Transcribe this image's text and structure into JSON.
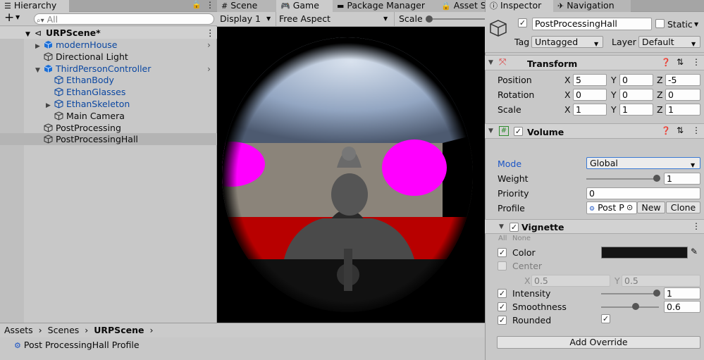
{
  "hierarchy": {
    "tab_label": "Hierarchy",
    "search_placeholder": "All",
    "add_label": "+",
    "scene": "URPScene*",
    "items": [
      {
        "label": "modernHouse",
        "style": "prefab",
        "expander": "collapsed",
        "depth": 1,
        "chevron": true
      },
      {
        "label": "Directional Light",
        "style": "normal",
        "expander": "none",
        "depth": 1,
        "chevron": false
      },
      {
        "label": "ThirdPersonController",
        "style": "prefab",
        "expander": "expanded",
        "depth": 1,
        "chevron": true
      },
      {
        "label": "EthanBody",
        "style": "prefab-child",
        "expander": "none",
        "depth": 2,
        "chevron": false
      },
      {
        "label": "EthanGlasses",
        "style": "prefab-child",
        "expander": "none",
        "depth": 2,
        "chevron": false
      },
      {
        "label": "EthanSkeleton",
        "style": "prefab-child",
        "expander": "collapsed",
        "depth": 2,
        "chevron": false
      },
      {
        "label": "Main Camera",
        "style": "normal",
        "expander": "none",
        "depth": 2,
        "chevron": false
      },
      {
        "label": "PostProcessing",
        "style": "normal",
        "expander": "none",
        "depth": 1,
        "chevron": false
      },
      {
        "label": "PostProcessingHall",
        "style": "selected",
        "expander": "none",
        "depth": 1,
        "chevron": false
      }
    ]
  },
  "center_tabs": {
    "scene": "Scene",
    "game": "Game",
    "package_manager": "Package Manager",
    "asset_store": "Asset S"
  },
  "game_toolbar": {
    "display": "Display 1",
    "aspect": "Free Aspect",
    "scale": "Scale"
  },
  "project": {
    "breadcrumb": [
      "Assets",
      "Scenes",
      "URPScene"
    ],
    "asset": "Post ProcessingHall Profile"
  },
  "inspector": {
    "tab_label": "Inspector",
    "navigation_tab": "Navigation",
    "object_name": "PostProcessingHall",
    "static_label": "Static",
    "tag_label": "Tag",
    "tag_value": "Untagged",
    "layer_label": "Layer",
    "layer_value": "Default",
    "transform": {
      "title": "Transform",
      "position_label": "Position",
      "rotation_label": "Rotation",
      "scale_label": "Scale",
      "position": {
        "x": "5",
        "y": "0",
        "z": "-5"
      },
      "rotation": {
        "x": "0",
        "y": "0",
        "z": "0"
      },
      "scale": {
        "x": "1",
        "y": "1",
        "z": "1"
      }
    },
    "volume": {
      "title": "Volume",
      "mode_label": "Mode",
      "mode_value": "Global",
      "weight_label": "Weight",
      "weight_value": "1",
      "priority_label": "Priority",
      "priority_value": "0",
      "profile_label": "Profile",
      "profile_value": "Post P",
      "new_label": "New",
      "clone_label": "Clone"
    },
    "vignette": {
      "title": "Vignette",
      "all_label": "All",
      "none_label": "None",
      "color_label": "Color",
      "color_value": "#141414",
      "center_label": "Center",
      "center_x": "0.5",
      "center_y": "0.5",
      "intensity_label": "Intensity",
      "intensity_value": "1",
      "smoothness_label": "Smoothness",
      "smoothness_value": "0.6",
      "rounded_label": "Rounded"
    },
    "add_override_label": "Add Override"
  },
  "axis_labels": {
    "x": "X",
    "y": "Y",
    "z": "Z"
  },
  "colors": {
    "prefab_blue": "#0b47a1",
    "selection": "#bdbdbd",
    "magenta": "#ff00ff",
    "red_band": "#c00000"
  }
}
